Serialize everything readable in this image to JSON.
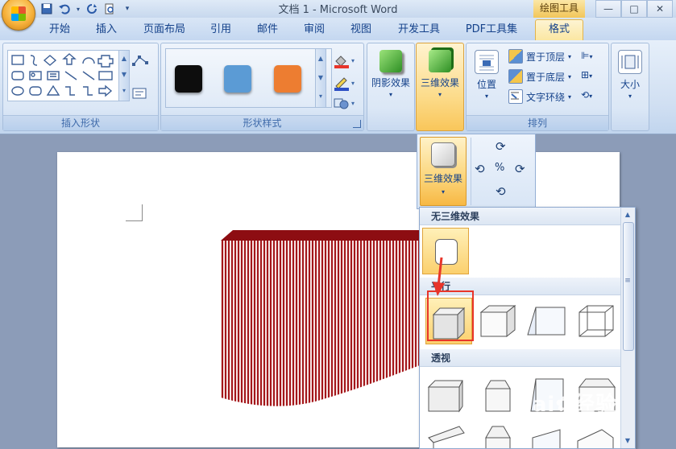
{
  "window": {
    "title": "文档 1 - Microsoft Word",
    "context_tab": "绘图工具",
    "controls": [
      "—",
      "□",
      "✕"
    ]
  },
  "qat": {
    "icons": [
      "save-icon",
      "undo-icon",
      "redo-icon",
      "print-preview-icon",
      "customize-icon"
    ]
  },
  "tabs": [
    {
      "label": "开始"
    },
    {
      "label": "插入"
    },
    {
      "label": "页面布局"
    },
    {
      "label": "引用"
    },
    {
      "label": "邮件"
    },
    {
      "label": "审阅"
    },
    {
      "label": "视图"
    },
    {
      "label": "开发工具"
    },
    {
      "label": "PDF工具集"
    },
    {
      "label": "格式",
      "active": true
    }
  ],
  "ribbon": {
    "insert_shapes": {
      "label": "插入形状"
    },
    "shape_styles": {
      "label": "形状样式",
      "swatches": [
        "#0d0d0d",
        "#5b9bd5",
        "#ed7d31"
      ]
    },
    "shadow": {
      "label": "阴影效果"
    },
    "effects3d": {
      "label": "三维效果"
    },
    "arrange": {
      "label": "排列",
      "position": "位置",
      "bring_front": "置于顶层",
      "send_back": "置于底层",
      "text_wrap": "文字环绕"
    },
    "size": {
      "label": "大小"
    }
  },
  "popup": {
    "button_label": "三维效果",
    "no_effect": "无三维效果",
    "parallel": "平行",
    "perspective": "透视"
  },
  "watermark": {
    "brand": "Bai",
    "cn": "经验",
    "url": "jingyan.baidu.com"
  },
  "colors": {
    "accent": "#fbd06e",
    "shape_fill": "#a3161a",
    "highlight": "#e8352a"
  }
}
